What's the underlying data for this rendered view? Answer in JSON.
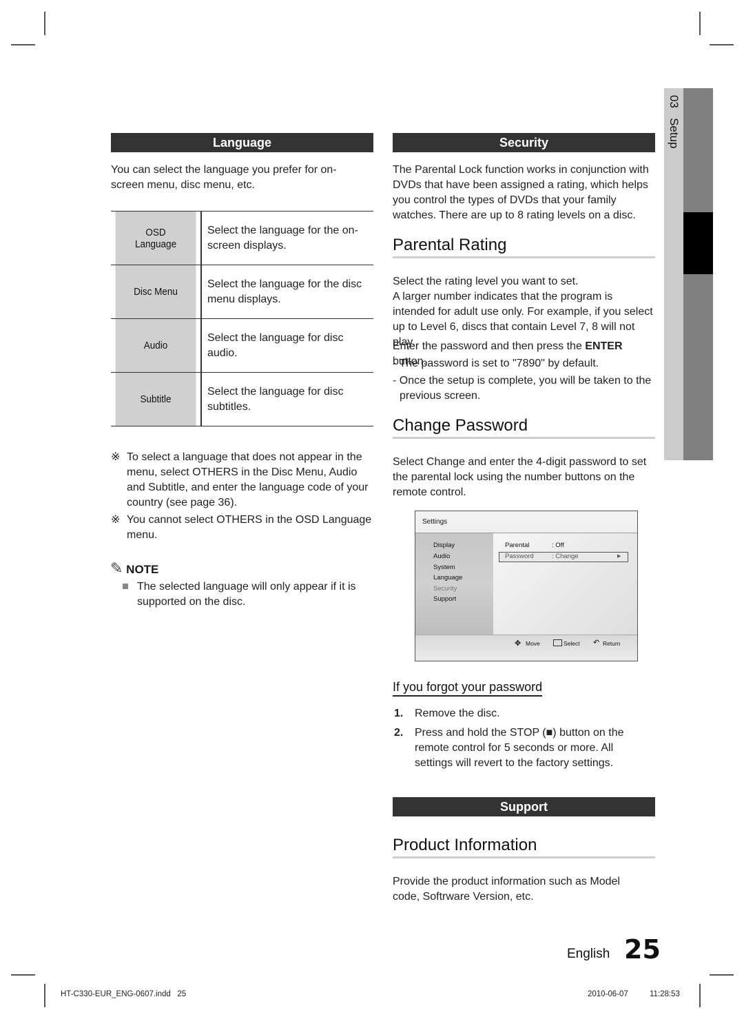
{
  "side_tab": {
    "chapter": "03",
    "section": "Setup"
  },
  "language": {
    "heading": "Language",
    "intro": "You can select the language you prefer for on-screen menu, disc menu, etc.",
    "table": [
      {
        "key": "OSD Language",
        "value": "Select the language for the on-screen displays."
      },
      {
        "key": "Disc Menu",
        "value": "Select the language for the disc menu displays."
      },
      {
        "key": "Audio",
        "value": "Select the language for disc audio."
      },
      {
        "key": "Subtitle",
        "value": "Select the language for disc subtitles."
      }
    ],
    "references": [
      "To select a language that does not appear in the menu, select OTHERS in the Disc Menu, Audio and Subtitle, and enter the language code of your country (see page 36).",
      "You cannot select OTHERS in the OSD Language menu."
    ],
    "reference_symbol": "※",
    "note_label": "NOTE",
    "notes": [
      "The selected language will only appear if it is supported on the disc."
    ]
  },
  "security": {
    "heading": "Security",
    "intro": "The Parental Lock function works in conjunction with DVDs that have been assigned a rating, which helps you control the types of DVDs that your family watches. There are up to 8 rating levels on a disc.",
    "parental_rating": {
      "title": "Parental Rating",
      "p1": "Select the rating level you want to set.",
      "p2": "A larger number indicates that the program is intended for adult use only. For example, if you select up to Level 6, discs that contain Level 7, 8 will not play.",
      "p3_pre": "Enter the password and then press the ",
      "p3_bold": "ENTER",
      "p3_post": " button.",
      "bullets": [
        "- The password is set to \"7890\" by default.",
        "- Once the setup is complete, you will be taken to the previous screen."
      ]
    },
    "change_password": {
      "title": "Change Password",
      "p_pre": "Select ",
      "p_bold": "Change",
      "p_post": " and enter the 4-digit password to set the parental lock using the number buttons on the remote control."
    },
    "osd": {
      "title": "Settings",
      "menu": [
        "Display",
        "Audio",
        "System",
        "Language",
        "Security",
        "Support"
      ],
      "active_menu": "Security",
      "rows": [
        {
          "label": "Parental",
          "value": ": Off"
        },
        {
          "label": "Password",
          "value": ": Change"
        }
      ],
      "footer": {
        "move": "Move",
        "select": "Select",
        "return": "Return"
      }
    },
    "forgot": {
      "title": "If you forgot your password",
      "steps": [
        {
          "num": "1.",
          "text": "Remove the disc."
        },
        {
          "num": "2.",
          "pre": "Press and hold the ",
          "bold": "STOP",
          "post": " (■) button on the remote control for 5 seconds or more. All settings will revert to the factory settings."
        }
      ]
    }
  },
  "support": {
    "heading": "Support",
    "product_info": {
      "title": "Product Information",
      "text": "Provide the product information such as Model code, Softrware Version, etc."
    }
  },
  "footer": {
    "language": "English",
    "page_number": "25",
    "file": "HT-C330-EUR_ENG-0607.indd   25",
    "date": "2010-06-07",
    "time": "11:28:53"
  }
}
